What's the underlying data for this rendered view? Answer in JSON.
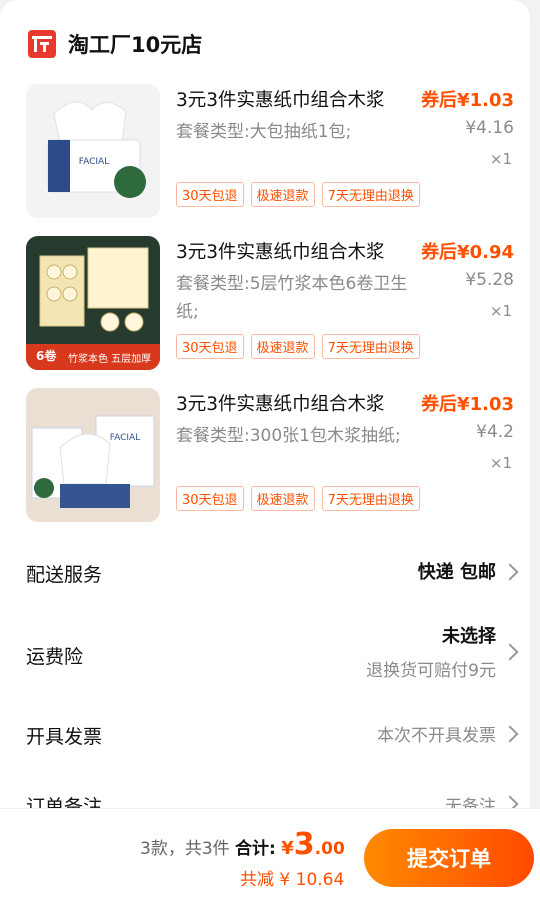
{
  "shop": {
    "name": "淘工厂10元店",
    "logo_text": "工厂"
  },
  "items": [
    {
      "title": "3元3件实惠纸巾组合木浆",
      "spec": "套餐类型:大包抽纸1包;",
      "coupon_price": "券后¥1.03",
      "original_price": "¥4.16",
      "quantity": "×1",
      "tags": [
        "30天包退",
        "极速退款",
        "7天无理由退换"
      ]
    },
    {
      "title": "3元3件实惠纸巾组合木浆",
      "spec": "套餐类型:5层竹浆本色6卷卫生纸;",
      "coupon_price": "券后¥0.94",
      "original_price": "¥5.28",
      "quantity": "×1",
      "tags": [
        "30天包退",
        "极速退款",
        "7天无理由退换"
      ]
    },
    {
      "title": "3元3件实惠纸巾组合木浆",
      "spec": "套餐类型:300张1包木浆抽纸;",
      "coupon_price": "券后¥1.03",
      "original_price": "¥4.2",
      "quantity": "×1",
      "tags": [
        "30天包退",
        "极速退款",
        "7天无理由退换"
      ]
    }
  ],
  "options": {
    "delivery": {
      "label": "配送服务",
      "value": "快递 包邮"
    },
    "shipping_insurance": {
      "label": "运费险",
      "value": "未选择",
      "note": "退换货可赔付9元"
    },
    "invoice": {
      "label": "开具发票",
      "value": "本次不开具发票"
    },
    "remark": {
      "label": "订单备注",
      "value": "无备注"
    }
  },
  "footer": {
    "count_text": "3款，共3件",
    "total_label": "合计:",
    "currency": "¥",
    "total_int": "3",
    "total_dec": ".00",
    "saving_text": "共减 ¥ 10.64",
    "submit_label": "提交订单"
  },
  "image_text": {
    "item1_pack": "FACIAL",
    "item2_roll": "6卷",
    "item2_banner": "竹浆本色 五层加厚",
    "item3_pack": "FACIAL"
  }
}
